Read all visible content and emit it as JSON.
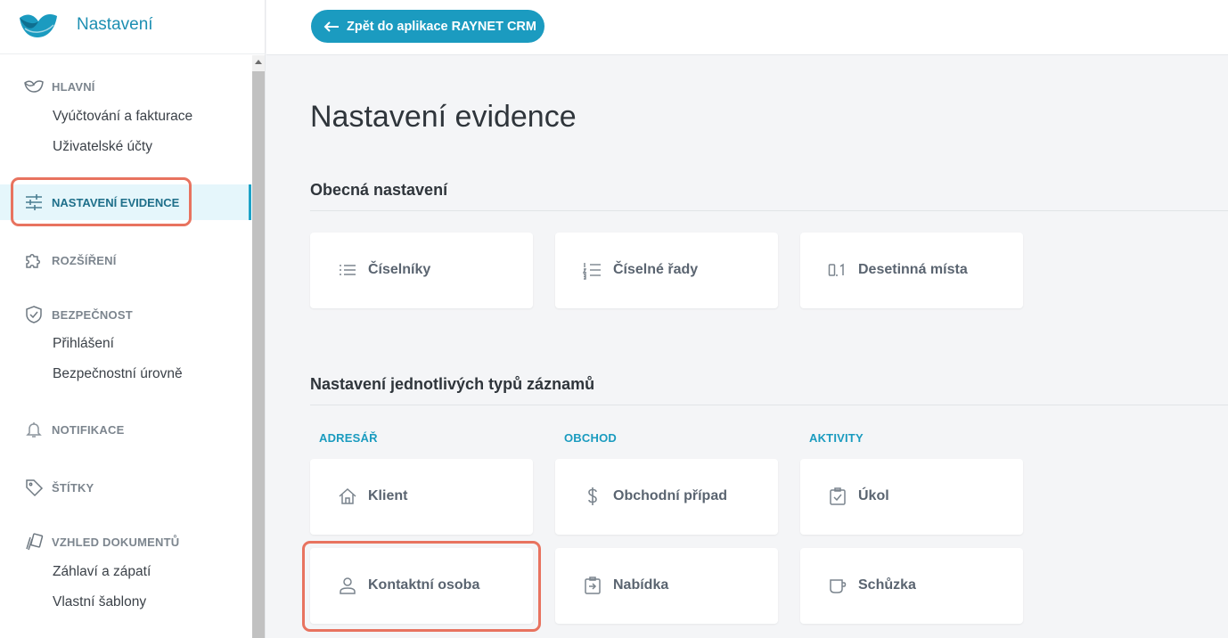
{
  "colors": {
    "accent": "#1b9bc0",
    "highlight": "#e8735f",
    "active_bg": "#e5f6fb"
  },
  "brand": {
    "title": "Nastavení"
  },
  "topbar": {
    "back_label": "Zpět do aplikace RAYNET CRM"
  },
  "sidebar": {
    "main": {
      "label": "HLAVNÍ",
      "icon": "raynet-icon",
      "links": [
        "Vyúčtování a fakturace",
        "Uživatelské účty"
      ]
    },
    "evidence": {
      "label": "NASTAVENÍ EVIDENCE",
      "icon": "sliders-icon",
      "active": true
    },
    "extensions": {
      "label": "ROZŠÍŘENÍ",
      "icon": "puzzle-icon"
    },
    "security": {
      "label": "BEZPEČNOST",
      "icon": "shield-icon",
      "links": [
        "Přihlášení",
        "Bezpečnostní úrovně"
      ]
    },
    "notifications": {
      "label": "NOTIFIKACE",
      "icon": "bell-icon"
    },
    "tags": {
      "label": "ŠTÍTKY",
      "icon": "tag-icon"
    },
    "documents": {
      "label": "VZHLED DOKUMENTŮ",
      "icon": "documents-icon",
      "links": [
        "Záhlaví a zápatí",
        "Vlastní šablony"
      ]
    }
  },
  "main": {
    "title": "Nastavení evidence",
    "general": {
      "title": "Obecná nastavení",
      "cards": [
        {
          "label": "Číselníky",
          "icon": "list-icon"
        },
        {
          "label": "Číselné řady",
          "icon": "numbered-list-icon"
        },
        {
          "label": "Desetinná místa",
          "icon": "decimal-icon"
        }
      ]
    },
    "records": {
      "title": "Nastavení jednotlivých typů záznamů",
      "columns": [
        {
          "label": "ADRESÁŘ",
          "cards": [
            {
              "label": "Klient",
              "icon": "home-icon"
            },
            {
              "label": "Kontaktní osoba",
              "icon": "person-icon"
            }
          ]
        },
        {
          "label": "OBCHOD",
          "cards": [
            {
              "label": "Obchodní případ",
              "icon": "dollar-icon"
            },
            {
              "label": "Nabídka",
              "icon": "offer-icon"
            }
          ]
        },
        {
          "label": "AKTIVITY",
          "cards": [
            {
              "label": "Úkol",
              "icon": "task-icon"
            },
            {
              "label": "Schůzka",
              "icon": "cup-icon"
            }
          ]
        }
      ]
    }
  }
}
